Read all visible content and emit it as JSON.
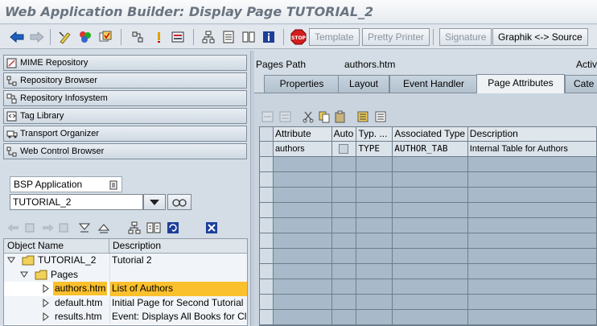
{
  "window": {
    "title": "Web Application Builder: Display Page TUTORIAL_2"
  },
  "toolbar": {
    "template_label": "Template",
    "pretty_printer_label": "Pretty Printer",
    "signature_label": "Signature",
    "graphik_label": "Graphik <-> Source"
  },
  "nav_buttons": [
    {
      "label": "MIME Repository",
      "icon": "mime-icon"
    },
    {
      "label": "Repository Browser",
      "icon": "hierarchy-icon"
    },
    {
      "label": "Repository Infosystem",
      "icon": "infosystem-icon"
    },
    {
      "label": "Tag Library",
      "icon": "tag-library-icon"
    },
    {
      "label": "Transport Organizer",
      "icon": "transport-icon"
    },
    {
      "label": "Web Control Browser",
      "icon": "hierarchy-icon"
    }
  ],
  "object_selector": {
    "type_label": "BSP Application",
    "value": "TUTORIAL_2"
  },
  "tree": {
    "headers": [
      "Object Name",
      "Description"
    ],
    "rows": [
      {
        "name": "TUTORIAL_2",
        "description": "Tutorial 2",
        "level": 0,
        "kind": "folder-open",
        "expand": "open"
      },
      {
        "name": "Pages",
        "description": "",
        "level": 1,
        "kind": "folder-open",
        "expand": "open"
      },
      {
        "name": "authors.htm",
        "description": "List of Authors",
        "level": 2,
        "kind": "leaf",
        "expand": "closed",
        "selected": true
      },
      {
        "name": "default.htm",
        "description": "Initial Page for Second Tutorial",
        "level": 2,
        "kind": "leaf",
        "expand": "closed"
      },
      {
        "name": "results.htm",
        "description": "Event: Displays All Books for Cl",
        "level": 2,
        "kind": "leaf",
        "expand": "closed"
      }
    ]
  },
  "page": {
    "path_label": "Pages Path",
    "path_value": "authors.htm",
    "status_label": "Activ"
  },
  "tabs": [
    "Properties",
    "Layout",
    "Event Handler",
    "Page Attributes",
    "Cate"
  ],
  "active_tab": "Page Attributes",
  "attributes_grid": {
    "headers": [
      "Attribute",
      "Auto",
      "Typ. ...",
      "Associated Type",
      "Description"
    ],
    "rows": [
      {
        "attribute": "authors",
        "auto": false,
        "typing": "TYPE",
        "associated_type": "AUTHOR_TAB",
        "description": "Internal Table for Authors"
      }
    ]
  },
  "colors": {
    "selection": "#fbc02d",
    "toolbar_bg": "#e1e7ed",
    "pane_bg": "#d4dde6",
    "grid_bg": "#a8bac9"
  }
}
